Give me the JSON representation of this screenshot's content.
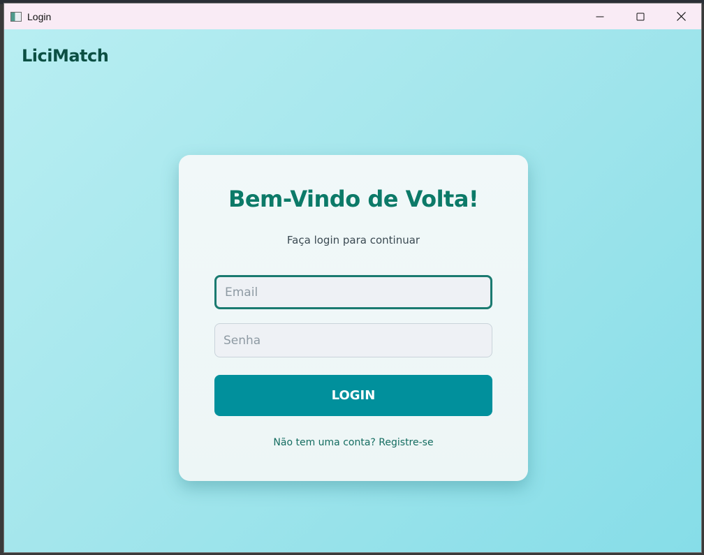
{
  "window": {
    "title": "Login",
    "controls": {
      "minimize": "minimize",
      "maximize": "maximize",
      "close": "close"
    }
  },
  "header": {
    "brand": "LiciMatch"
  },
  "login_card": {
    "title": "Bem-Vindo de Volta!",
    "subtitle": "Faça login para continuar",
    "email": {
      "value": "",
      "placeholder": "Email"
    },
    "password": {
      "value": "",
      "placeholder": "Senha"
    },
    "login_button_label": "LOGIN",
    "register_link": "Não tem uma conta? Registre-se"
  },
  "colors": {
    "background_start": "#b8eef2",
    "background_end": "#86dde8",
    "brand_text": "#0b4f43",
    "title_text": "#0c7a68",
    "button": "#01909c",
    "link_text": "#146c60",
    "titlebar": "#f9ebf5"
  },
  "icons": {
    "app": "window-app-icon",
    "minimize": "minimize-icon",
    "maximize": "maximize-icon",
    "close": "close-icon"
  }
}
